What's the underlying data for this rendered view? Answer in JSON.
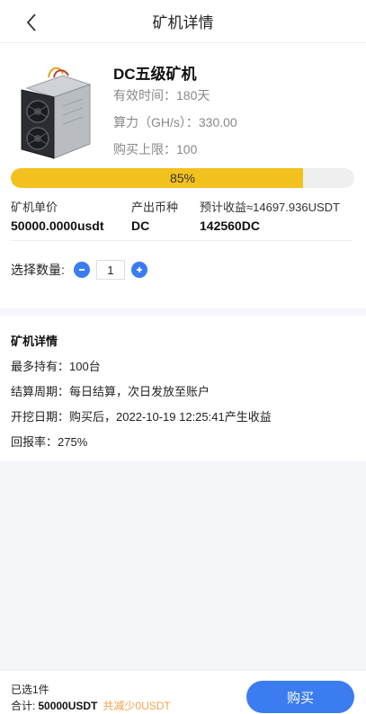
{
  "header": {
    "title": "矿机详情",
    "back_icon": "chevron-left-icon"
  },
  "product": {
    "name": "DC五级矿机",
    "validity": "有效时间：180天",
    "hashrate": "算力（GH/s）：330.00",
    "purchase_limit": "购买上限：100",
    "progress_label": "85%",
    "progress_value": 0.85,
    "unit_price_label": "矿机单价",
    "unit_price_value": "50000.0000usdt",
    "output_currency_label": "产出币种",
    "output_currency_value": "DC",
    "expected_income_label": "预计收益≈14697.936USDT",
    "expected_income_value": "142560DC",
    "quantity_label": "选择数量:",
    "quantity_value": "1"
  },
  "details": {
    "title": "矿机详情",
    "max_hold": "最多持有：100台",
    "settlement": "结算周期：每日结算，次日发放至账户",
    "mining_date": "开挖日期：购买后，2022-10-19 12:25:41产生收益",
    "return_rate": "回报率：275%"
  },
  "footer": {
    "selected": "已选1件",
    "total_label": "合计:",
    "total_amount": "50000USDT",
    "saving": "共减少0USDT",
    "buy_label": "购买"
  },
  "colors": {
    "accent": "#3b7cf0",
    "progress": "#f2c11e",
    "saving": "#f3a34a"
  }
}
